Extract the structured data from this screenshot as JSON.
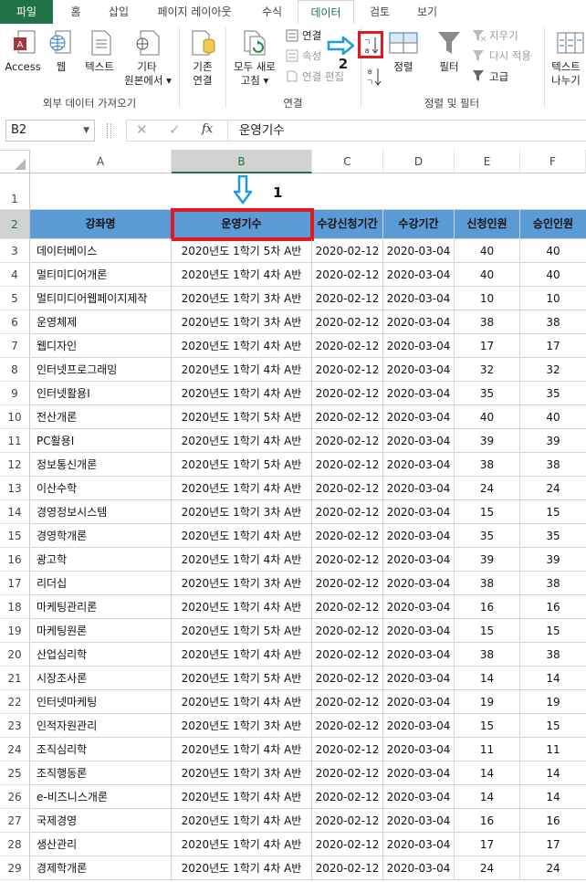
{
  "tabs": [
    "파일",
    "홈",
    "삽입",
    "페이지 레이아웃",
    "수식",
    "데이터",
    "검토",
    "보기"
  ],
  "ribbon": {
    "access": "Access",
    "web": "웹",
    "text": "텍스트",
    "other_line1": "기타",
    "other_line2": "원본에서 ▾",
    "existing_line1": "기존",
    "existing_line2": "연결",
    "group_external": "외부 데이터 가져오기",
    "refresh_line1": "모두 새로",
    "refresh_line2": "고침 ▾",
    "connections": "연결",
    "properties": "속성",
    "edit_links": "연결 편집",
    "group_connections": "연결",
    "sort": "정렬",
    "filter": "필터",
    "clear": "지우기",
    "reapply": "다시 적용",
    "advanced": "고급",
    "group_sortfilter": "정렬 및 필터",
    "text_to_cols_line1": "텍스트",
    "text_to_cols_line2": "나누기",
    "step2": "2"
  },
  "namebox": "B2",
  "formula": "운영기수",
  "columns": [
    "A",
    "B",
    "C",
    "D",
    "E",
    "F"
  ],
  "step1": "1",
  "headers": [
    "강좌명",
    "운영기수",
    "수강신청기간",
    "수강기간",
    "신청인원",
    "승인인원"
  ],
  "rows": [
    [
      "데이터베이스",
      "2020년도 1학기 5차 A반",
      "2020-02-12",
      "2020-03-04",
      "40",
      "40"
    ],
    [
      "멀티미디어개론",
      "2020년도 1학기 4차 A반",
      "2020-02-12",
      "2020-03-04",
      "40",
      "40"
    ],
    [
      "멀티미디어웹페이지제작",
      "2020년도 1학기 3차 A반",
      "2020-02-12",
      "2020-03-04",
      "10",
      "10"
    ],
    [
      "운영체제",
      "2020년도 1학기 3차 A반",
      "2020-02-12",
      "2020-03-04",
      "38",
      "38"
    ],
    [
      "웹디자인",
      "2020년도 1학기 4차 A반",
      "2020-02-12",
      "2020-03-04",
      "17",
      "17"
    ],
    [
      "인터넷프로그래밍",
      "2020년도 1학기 4차 A반",
      "2020-02-12",
      "2020-03-04",
      "32",
      "32"
    ],
    [
      "인터넷활용Ⅰ",
      "2020년도 1학기 4차 A반",
      "2020-02-12",
      "2020-03-04",
      "35",
      "35"
    ],
    [
      "전산개론",
      "2020년도 1학기 5차 A반",
      "2020-02-12",
      "2020-03-04",
      "40",
      "40"
    ],
    [
      "PC활용Ⅰ",
      "2020년도 1학기 4차 A반",
      "2020-02-12",
      "2020-03-04",
      "39",
      "39"
    ],
    [
      "정보통신개론",
      "2020년도 1학기 5차 A반",
      "2020-02-12",
      "2020-03-04",
      "38",
      "38"
    ],
    [
      "이산수학",
      "2020년도 1학기 4차 A반",
      "2020-02-12",
      "2020-03-04",
      "24",
      "24"
    ],
    [
      "경영정보시스템",
      "2020년도 1학기 3차 A반",
      "2020-02-12",
      "2020-03-04",
      "15",
      "15"
    ],
    [
      "경영학개론",
      "2020년도 1학기 4차 A반",
      "2020-02-12",
      "2020-03-04",
      "35",
      "35"
    ],
    [
      "광고학",
      "2020년도 1학기 4차 A반",
      "2020-02-12",
      "2020-03-04",
      "39",
      "39"
    ],
    [
      "리더십",
      "2020년도 1학기 3차 A반",
      "2020-02-12",
      "2020-03-04",
      "38",
      "38"
    ],
    [
      "마케팅관리론",
      "2020년도 1학기 4차 A반",
      "2020-02-12",
      "2020-03-04",
      "16",
      "16"
    ],
    [
      "마케팅원론",
      "2020년도 1학기 5차 A반",
      "2020-02-12",
      "2020-03-04",
      "15",
      "15"
    ],
    [
      "산업심리학",
      "2020년도 1학기 4차 A반",
      "2020-02-12",
      "2020-03-04",
      "38",
      "38"
    ],
    [
      "시장조사론",
      "2020년도 1학기 5차 A반",
      "2020-02-12",
      "2020-03-04",
      "14",
      "14"
    ],
    [
      "인터넷마케팅",
      "2020년도 1학기 4차 A반",
      "2020-02-12",
      "2020-03-04",
      "19",
      "19"
    ],
    [
      "인적자원관리",
      "2020년도 1학기 3차 A반",
      "2020-02-12",
      "2020-03-04",
      "15",
      "15"
    ],
    [
      "조직심리학",
      "2020년도 1학기 4차 A반",
      "2020-02-12",
      "2020-03-04",
      "11",
      "11"
    ],
    [
      "조직행동론",
      "2020년도 1학기 3차 A반",
      "2020-02-12",
      "2020-03-04",
      "14",
      "14"
    ],
    [
      "e-비즈니스개론",
      "2020년도 1학기 4차 A반",
      "2020-02-12",
      "2020-03-04",
      "14",
      "14"
    ],
    [
      "국제경영",
      "2020년도 1학기 4차 A반",
      "2020-02-12",
      "2020-03-04",
      "16",
      "16"
    ],
    [
      "생산관리",
      "2020년도 1학기 4차 A반",
      "2020-02-12",
      "2020-03-04",
      "17",
      "17"
    ],
    [
      "경제학개론",
      "2020년도 1학기 4차 A반",
      "2020-02-12",
      "2020-03-04",
      "24",
      "24"
    ]
  ],
  "colors": {
    "accent": "#217346",
    "header_fill": "#5b9bd5",
    "highlight": "#e2191e",
    "arrow": "#1f9bd8"
  }
}
